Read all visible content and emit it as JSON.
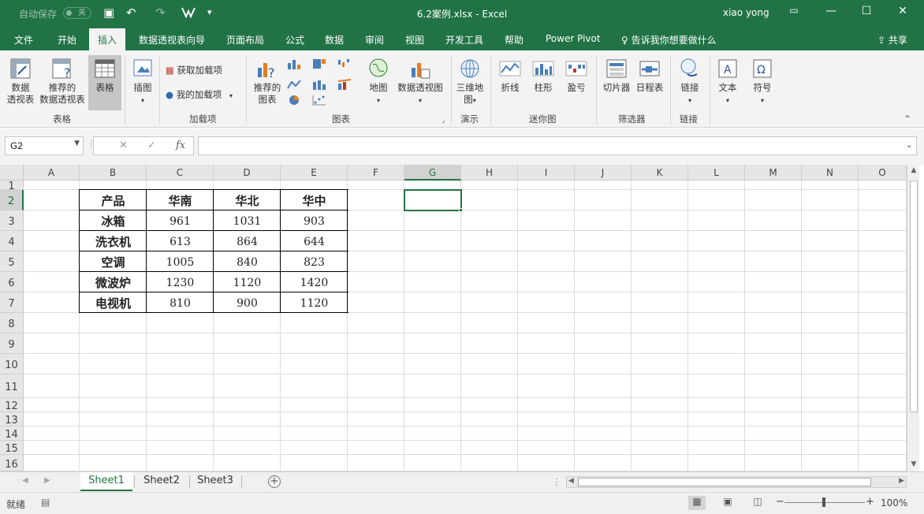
{
  "titlebar": {
    "autosave_label": "自动保存",
    "autosave_state": "关",
    "title": "6.2案例.xlsx  -  Excel",
    "user": "xiao yong",
    "qat_save": "▣",
    "qat_undo": "↶",
    "qat_redo": "↷",
    "qat_more": "▾"
  },
  "menu": {
    "tabs": [
      "文件",
      "开始",
      "插入",
      "数据透视表向导",
      "页面布局",
      "公式",
      "数据",
      "审阅",
      "视图",
      "开发工具",
      "帮助",
      "Power Pivot"
    ],
    "active_tab": "插入",
    "tell_me": "告诉我你想要做什么",
    "share": "共享"
  },
  "ribbon": {
    "groups": {
      "tables": "表格",
      "addins": "加载项",
      "charts": "图表",
      "tours": "演示",
      "sparklines": "迷你图",
      "filters": "筛选器",
      "links": "链接"
    },
    "buttons": {
      "pivot_table": "数据\n透视表",
      "recommended_pivot": "推荐的\n数据透视表",
      "table": "表格",
      "illustrations": "插图",
      "get_addins": "获取加载项",
      "my_addins": "我的加载项",
      "recommended_charts": "推荐的\n图表",
      "maps": "地图",
      "pivot_chart": "数据透视图",
      "3d_map": "三维地\n图",
      "line_sparkline": "折线",
      "column_sparkline": "柱形",
      "winloss_sparkline": "盈亏",
      "slicer": "切片器",
      "timeline": "日程表",
      "link": "链接",
      "text": "文本",
      "symbol": "符号"
    }
  },
  "formula_bar": {
    "name_box": "G2",
    "fx": "fx",
    "cancel": "✕",
    "enter": "✓",
    "value": ""
  },
  "grid": {
    "columns": [
      "A",
      "B",
      "C",
      "D",
      "E",
      "F",
      "G",
      "H",
      "I",
      "J",
      "K",
      "L",
      "M",
      "N",
      "O"
    ],
    "rows": [
      "1",
      "2",
      "3",
      "4",
      "5",
      "6",
      "7",
      "8",
      "9",
      "10",
      "11",
      "12",
      "13",
      "14",
      "15",
      "16"
    ],
    "selected_cell": "G2"
  },
  "table": {
    "headers": [
      "产品",
      "华南",
      "华北",
      "华中"
    ],
    "rows": [
      [
        "冰箱",
        "961",
        "1031",
        "903"
      ],
      [
        "洗衣机",
        "613",
        "864",
        "644"
      ],
      [
        "空调",
        "1005",
        "840",
        "823"
      ],
      [
        "微波炉",
        "1230",
        "1120",
        "1420"
      ],
      [
        "电视机",
        "810",
        "900",
        "1120"
      ]
    ]
  },
  "sheets": {
    "tabs": [
      "Sheet1",
      "Sheet2",
      "Sheet3"
    ],
    "active": "Sheet1",
    "add": "+"
  },
  "status": {
    "ready": "就绪",
    "zoom": "100%",
    "zoom_minus": "−",
    "zoom_plus": "+"
  },
  "colors": {
    "accent": "#217346"
  }
}
